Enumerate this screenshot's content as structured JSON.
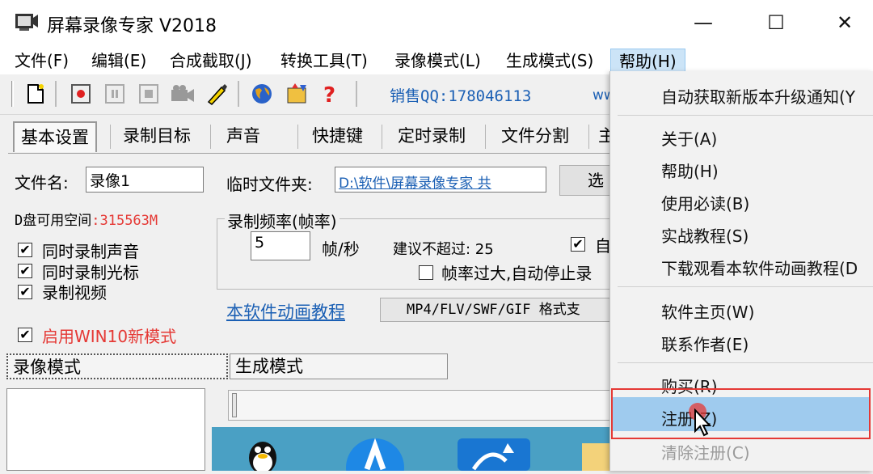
{
  "window": {
    "title": "屏幕录像专家 V2018",
    "minimize": "—",
    "maximize": "☐",
    "close": "✕"
  },
  "menubar": [
    {
      "label": "文件(F)"
    },
    {
      "label": "编辑(E)"
    },
    {
      "label": "合成截取(J)"
    },
    {
      "label": "转换工具(T)"
    },
    {
      "label": "录像模式(L)"
    },
    {
      "label": "生成模式(S)"
    },
    {
      "label": "帮助(H)"
    }
  ],
  "toolbar": {
    "sales_qq": "销售QQ:178046113",
    "www": "ww"
  },
  "tabs": [
    "基本设置",
    "录制目标",
    "声音",
    "快捷键",
    "定时录制",
    "文件分割",
    "主"
  ],
  "basic": {
    "filename_label": "文件名:",
    "filename_value": "录像1",
    "temp_folder_label": "临时文件夹:",
    "temp_folder_value": "D:\\软件\\屏幕录像专家 共",
    "select_button": "选",
    "disk_space_label": "D盘可用空间",
    "disk_space_value": ":315563M",
    "record_audio": "同时录制声音",
    "record_cursor": "同时录制光标",
    "record_video": "录制视频",
    "win10_mode": "启用WIN10新模式"
  },
  "framerate": {
    "group_title": "录制频率(帧率)",
    "value": "5",
    "unit": "帧/秒",
    "suggest": "建议不超过: 25",
    "auto_label": "自",
    "auto_stop": "帧率过大,自动停止录"
  },
  "tutorial_link": "本软件动画教程",
  "format_button": "MP4/FLV/SWF/GIF  格式支",
  "mode_tabs": {
    "record": "录像模式",
    "generate": "生成模式"
  },
  "help_menu": {
    "items": [
      "自动获取新版本升级通知(Y",
      "关于(A)",
      "帮助(H)",
      "使用必读(B)",
      "实战教程(S)",
      "下载观看本软件动画教程(D",
      "软件主页(W)",
      "联系作者(E)",
      "购买(R)",
      "注册(Z)",
      "清除注册(C)"
    ]
  },
  "colors": {
    "accent_blue": "#1a5fb4",
    "disk_red": "#e53935",
    "highlight": "#9fcbee",
    "annotation_box": "#e53935"
  }
}
